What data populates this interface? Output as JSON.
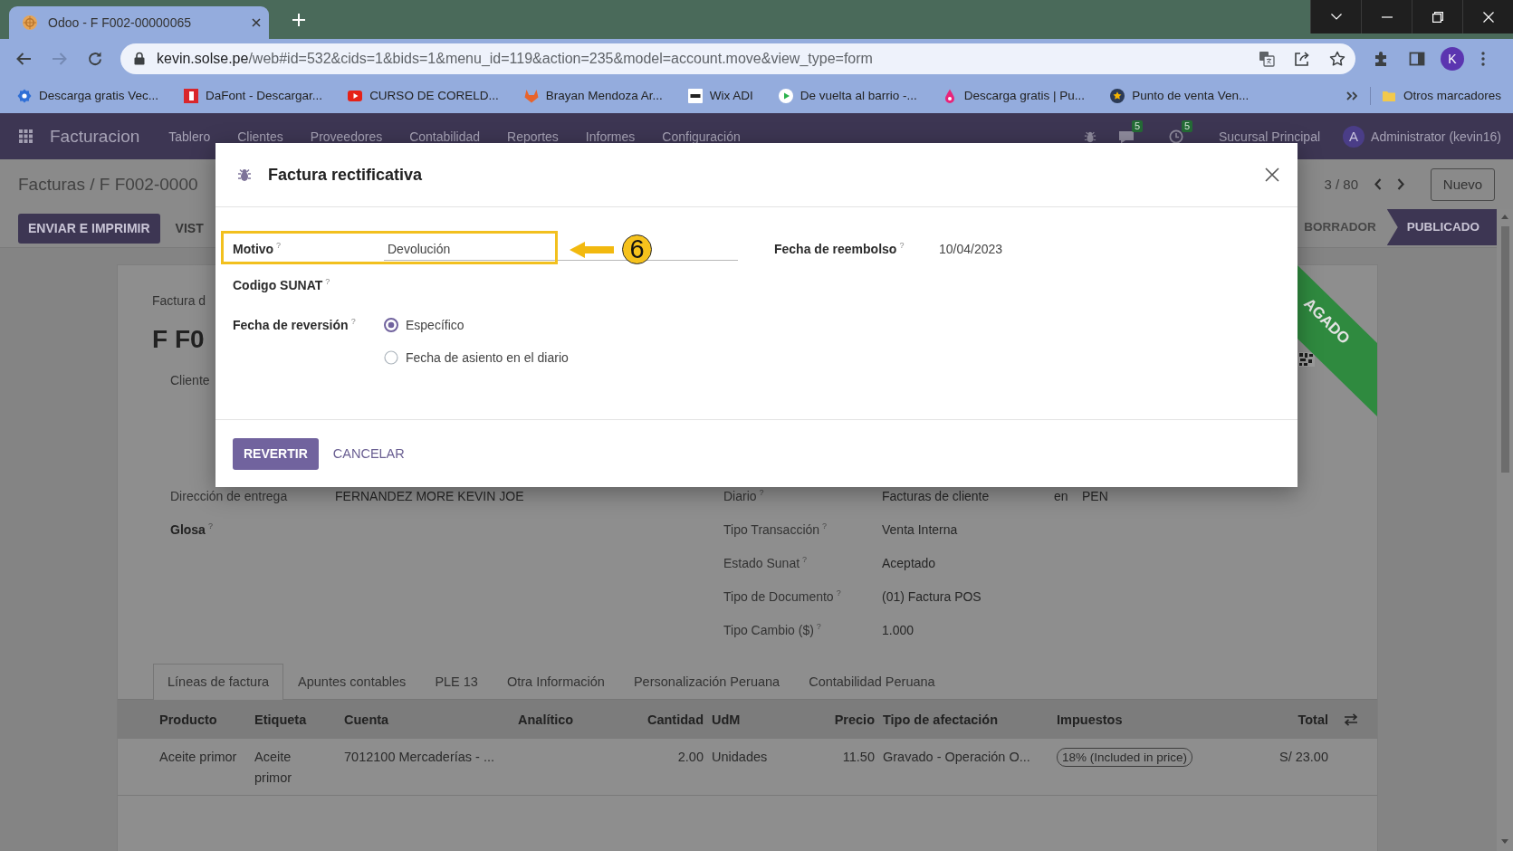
{
  "browser": {
    "tabs": [
      {
        "title": "Odoo - F F002-00000065",
        "selected": true
      }
    ],
    "back": {
      "disabled": false
    },
    "forward": {
      "disabled": true
    },
    "url_host": "kevin.solse.pe",
    "url_rest": "/web#id=532&cids=1&bids=1&menu_id=119&action=235&model=account.move&view_type=form",
    "profile_initial": "K",
    "bookmarks": [
      {
        "label": "Descarga gratis Vec...",
        "kind": "badge"
      },
      {
        "label": "DaFont - Descargar...",
        "kind": "square"
      },
      {
        "label": "CURSO DE CORELD...",
        "kind": "play"
      },
      {
        "label": "Brayan Mendoza Ar...",
        "kind": "fox"
      },
      {
        "label": "Wix ADI",
        "kind": "tile"
      },
      {
        "label": "De vuelta al barrio -...",
        "kind": "playcircle"
      },
      {
        "label": "Descarga gratis | Pu...",
        "kind": "drop"
      },
      {
        "label": "Punto de venta Ven...",
        "kind": "star"
      }
    ],
    "other_bookmarks": "Otros marcadores"
  },
  "navbar": {
    "app": "Facturacion",
    "menu": [
      "Tablero",
      "Clientes",
      "Proveedores",
      "Contabilidad",
      "Reportes",
      "Informes",
      "Configuración"
    ],
    "messages_count": "5",
    "activities_count": "5",
    "company": "Sucursal Principal",
    "user_initial": "A",
    "user": "Administrator (kevin16)"
  },
  "control_panel": {
    "breadcrumb": "Facturas / F F002-0000",
    "pager": "3 / 80",
    "new_button": "Nuevo"
  },
  "form": {
    "buttons": [
      {
        "label": "ENVIAR E IMPRIMIR",
        "kind": "primary"
      },
      {
        "label": "VIST",
        "kind": "secondary"
      }
    ],
    "status_steps": [
      {
        "label": "BORRADOR",
        "selected": false
      },
      {
        "label": "PUBLICADO",
        "selected": true
      }
    ]
  },
  "sheet": {
    "ribbon": "AGADO",
    "subtitle": "Factura d",
    "title": "F F0",
    "customer_label": "Cliente",
    "left_fields": [
      {
        "label": "Dirección de entrega",
        "value": "FERNANDEZ MORE KEVIN JOE",
        "bold": false
      },
      {
        "label": "Glosa$^{?}$",
        "bold": true
      }
    ],
    "right_fields": [
      {
        "label": "Diario$^{?}$",
        "value": "Facturas de cliente",
        "extra_label": "en",
        "extra_value": "PEN"
      },
      {
        "label": "Tipo Transacción$^{?}$",
        "value": "Venta Interna"
      },
      {
        "label": "Estado Sunat$^{?}$",
        "value": "Aceptado"
      },
      {
        "label": "Tipo de Documento$^{?}$",
        "value": "(01) Factura POS"
      },
      {
        "label": "Tipo Cambio ($)$^{?}$",
        "value": "1.000"
      }
    ],
    "tabs": [
      {
        "label": "Líneas de factura",
        "selected": true
      },
      {
        "label": "Apuntes contables",
        "selected": false
      },
      {
        "label": "PLE 13",
        "selected": false
      },
      {
        "label": "Otra Información",
        "selected": false
      },
      {
        "label": "Personalización Peruana",
        "selected": false
      },
      {
        "label": "Contabilidad Peruana",
        "selected": false
      }
    ],
    "table": {
      "columns": [
        {
          "label": "Producto",
          "kind": "text"
        },
        {
          "label": "Etiqueta",
          "kind": "text"
        },
        {
          "label": "Cuenta",
          "kind": "text"
        },
        {
          "label": "Analítico",
          "kind": "text"
        },
        {
          "label": "Cantidad",
          "kind": "number"
        },
        {
          "label": "UdM",
          "kind": "text"
        },
        {
          "label": "Precio",
          "kind": "number"
        },
        {
          "label": "Tipo de afectación",
          "kind": "text"
        },
        {
          "label": "Impuestos",
          "kind": "text"
        },
        {
          "label": "Total",
          "kind": "number"
        }
      ],
      "rows": [
        {
          "product": "Aceite primor",
          "label": "Aceite primor",
          "account": "7012100 Mercaderías - ...",
          "quantity": "2.00",
          "uom": "Unidades",
          "price": "11.50",
          "tax_type": "Gravado - Operación O...",
          "taxes": [
            "18% (Included in price)"
          ],
          "total": "S/ 23.00"
        }
      ]
    }
  },
  "dialog": {
    "title": "Factura rectificativa",
    "reason": {
      "label": "Motivo$^{?}$",
      "value": "Devolución"
    },
    "refund_date": {
      "label": "Fecha de reembolso$^{?}$",
      "value": "10/04/2023"
    },
    "sunat_code": {
      "label": "Codigo SUNAT$^{?}$"
    },
    "reversal_date": {
      "label": "Fecha de reversión$^{?}$",
      "options": [
        {
          "label": "Específico",
          "selected": true
        },
        {
          "label": "Fecha de asiento en el diario",
          "selected": false
        }
      ]
    },
    "buttons": [
      {
        "label": "REVERTIR",
        "kind": "primary"
      },
      {
        "label": "CANCELAR",
        "kind": "link"
      }
    ]
  },
  "annotation": {
    "step": "6"
  }
}
